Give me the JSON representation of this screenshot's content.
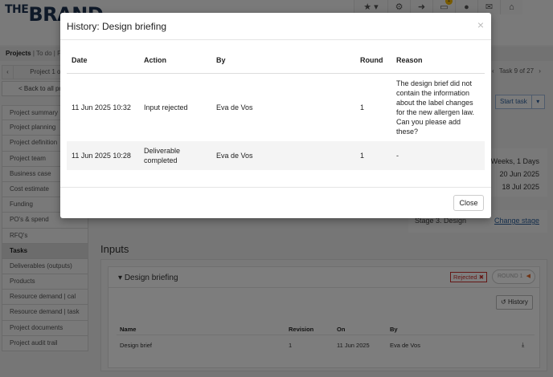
{
  "brand": {
    "prefix": "THE",
    "name": "BRAND"
  },
  "topbar": {
    "icons": [
      {
        "icon": "star-icon",
        "glyph": "★ ▾"
      },
      {
        "icon": "gear-icon",
        "glyph": "⚙"
      },
      {
        "icon": "sign-out-icon",
        "glyph": "➜"
      },
      {
        "icon": "inbox-icon",
        "glyph": "▭",
        "badge": "1"
      },
      {
        "icon": "user-icon",
        "glyph": "●"
      },
      {
        "icon": "envelope-icon",
        "glyph": "✉"
      },
      {
        "icon": "home-icon",
        "glyph": "⌂"
      }
    ]
  },
  "breadcrumb": {
    "projects": "Projects",
    "sep": "|",
    "todo": "To do",
    "more": "Pl"
  },
  "pager": {
    "prev": "‹",
    "label": "Project 1 of 1"
  },
  "back_button": "< Back to all pro",
  "sidebar": {
    "items": [
      {
        "label": "Project summary"
      },
      {
        "label": "Project planning"
      },
      {
        "label": "Project definition"
      },
      {
        "label": "Project team"
      },
      {
        "label": "Business case"
      },
      {
        "label": "Cost estimate"
      },
      {
        "label": "Funding"
      },
      {
        "label": "PO's & spend"
      },
      {
        "label": "RFQ's"
      },
      {
        "label": "Tasks",
        "active": true
      },
      {
        "label": "Deliverables (outputs)"
      },
      {
        "label": "Products"
      },
      {
        "label": "Resource demand | cal"
      },
      {
        "label": "Resource demand | task"
      },
      {
        "label": "Project documents"
      },
      {
        "label": "Project audit trail"
      }
    ]
  },
  "task_pager": {
    "prev": "‹",
    "label": "Task 9 of 27",
    "next": "›"
  },
  "start_task": {
    "label": "Start task",
    "caret": "▾"
  },
  "info_panel": {
    "duration": "Weeks, 1 Days",
    "start": "20 Jun 2025",
    "end": "18 Jul 2025"
  },
  "stage_panel": {
    "stage": "Stage 3. Design",
    "change_link": "Change stage"
  },
  "inputs": {
    "title": "Inputs",
    "card_title": "Design briefing",
    "rejected_badge": "Rejected",
    "round_button": "ROUND 1",
    "history_button": "History",
    "columns": [
      "Name",
      "Revision",
      "On",
      "By"
    ],
    "rows": [
      {
        "name": "Design brief",
        "revision": "1",
        "on": "11 Jun 2025",
        "by": "Eva de Vos"
      }
    ]
  },
  "modal": {
    "title": "History: Design briefing",
    "close_x": "×",
    "close_button": "Close",
    "columns": {
      "date": "Date",
      "action": "Action",
      "by": "By",
      "round": "Round",
      "reason": "Reason"
    },
    "rows": [
      {
        "date": "11 Jun 2025 10:32",
        "action": "Input rejected",
        "by": "Eva de Vos",
        "round": "1",
        "reason": "The design brief did not contain the information about the label changes for the new allergen law. Can you please add these?"
      },
      {
        "date": "11 Jun 2025 10:28",
        "action": "Deliverable completed",
        "by": "Eva de Vos",
        "round": "1",
        "reason": "-"
      }
    ]
  }
}
